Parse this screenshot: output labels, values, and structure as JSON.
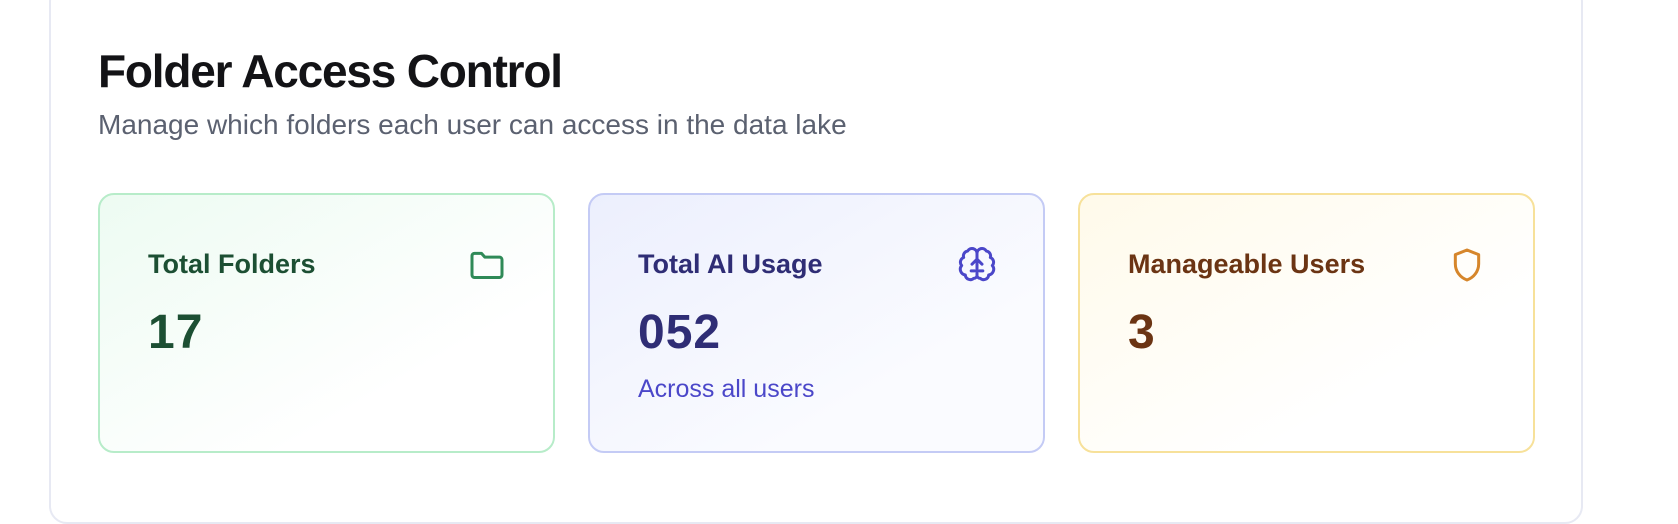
{
  "header": {
    "title": "Folder Access Control",
    "subtitle": "Manage which folders each user can access in the data lake"
  },
  "stats": [
    {
      "label": "Total Folders",
      "value": "17",
      "note": "",
      "icon": "folder-icon",
      "accent": "#2f8a57"
    },
    {
      "label": "Total AI Usage",
      "value": "052",
      "note": "Across all users",
      "icon": "brain-icon",
      "accent": "#4b47c9"
    },
    {
      "label": "Manageable Users",
      "value": "3",
      "note": "",
      "icon": "shield-icon",
      "accent": "#d6862b"
    }
  ]
}
